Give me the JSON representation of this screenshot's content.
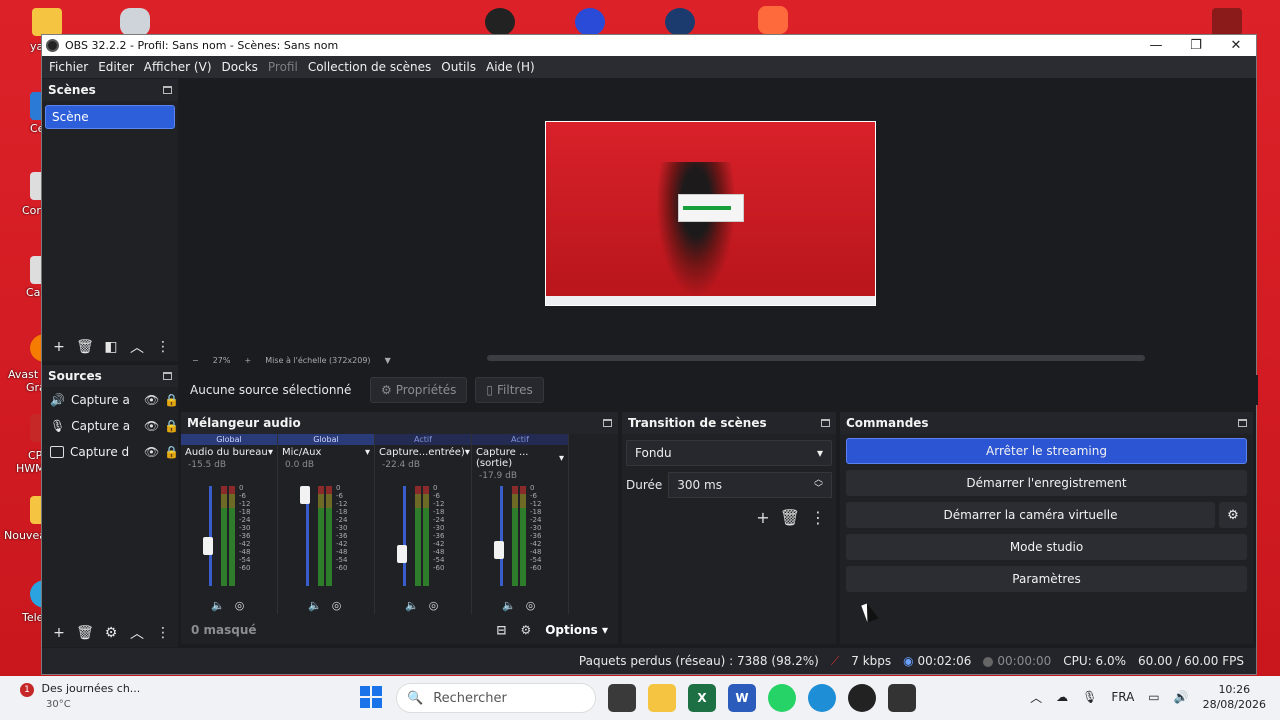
{
  "window": {
    "title": "OBS 32.2.2 - Profil: Sans nom - Scènes: Sans nom",
    "min": "—",
    "max": "❐",
    "close": "✕"
  },
  "menu": {
    "items": [
      "Fichier",
      "Editer",
      "Afficher (V)",
      "Docks",
      "Profil",
      "Collection de scènes",
      "Outils",
      "Aide (H)"
    ]
  },
  "scenes": {
    "title": "Scènes",
    "items": [
      "Scène"
    ]
  },
  "sources": {
    "title": "Sources",
    "items": [
      "Capture a",
      "Capture a",
      "Capture d"
    ]
  },
  "preview": {
    "zoom": "27%",
    "scale_label": "Mise à l'échelle (372x209)"
  },
  "context": {
    "no_source": "Aucune source sélectionné",
    "properties": "Propriétés",
    "filters": "Filtres"
  },
  "mixer": {
    "title": "Mélangeur audio",
    "channels": [
      {
        "badge": "Global",
        "name": "Audio du bureau",
        "db": "-15.5 dB",
        "level": 0.38
      },
      {
        "badge": "Global",
        "name": "Mic/Aux",
        "db": "0.0 dB",
        "level": 1.0
      },
      {
        "badge": "Actif",
        "name": "Capture...entrée)",
        "db": "-22.4 dB",
        "level": 0.28
      },
      {
        "badge": "Actif",
        "name": "Capture ...(sortie)",
        "db": "-17.9 dB",
        "level": 0.33
      }
    ],
    "scale": [
      "0",
      "-6",
      "-12",
      "-18",
      "-24",
      "-30",
      "-36",
      "-42",
      "-48",
      "-54",
      "-60"
    ],
    "hidden": "0 masqué",
    "options": "Options"
  },
  "transition": {
    "title": "Transition de scènes",
    "selected": "Fondu",
    "duration_label": "Durée",
    "duration_value": "300 ms"
  },
  "commands": {
    "title": "Commandes",
    "stop_streaming": "Arrêter le streaming",
    "start_recording": "Démarrer l'enregistrement",
    "virtual_cam": "Démarrer la caméra virtuelle",
    "studio_mode": "Mode studio",
    "settings": "Paramètres"
  },
  "status": {
    "dropped": "Paquets perdus (réseau) : 7388 (98.2%)",
    "kbps": "7 kbps",
    "stream_time": "00:02:06",
    "rec_time": "00:00:00",
    "cpu": "CPU: 6.0%",
    "fps": "60.00 / 60.00 FPS"
  },
  "taskbar": {
    "weather_title": "Des journées ch...",
    "weather_temp": "30°C",
    "notif_count": "1",
    "search_placeholder": "Rechercher",
    "lang": "FRA",
    "time": "10:26",
    "date": "28/08/2026"
  },
  "desktop_labels": [
    "ya",
    "Ce",
    "Cor",
    "Ca",
    "Avast A",
    "Gra",
    "CP",
    "HWM",
    "Nouvea",
    "Tele"
  ],
  "colors": {
    "accent": "#2b55d2",
    "desktop": "#d81f26"
  }
}
